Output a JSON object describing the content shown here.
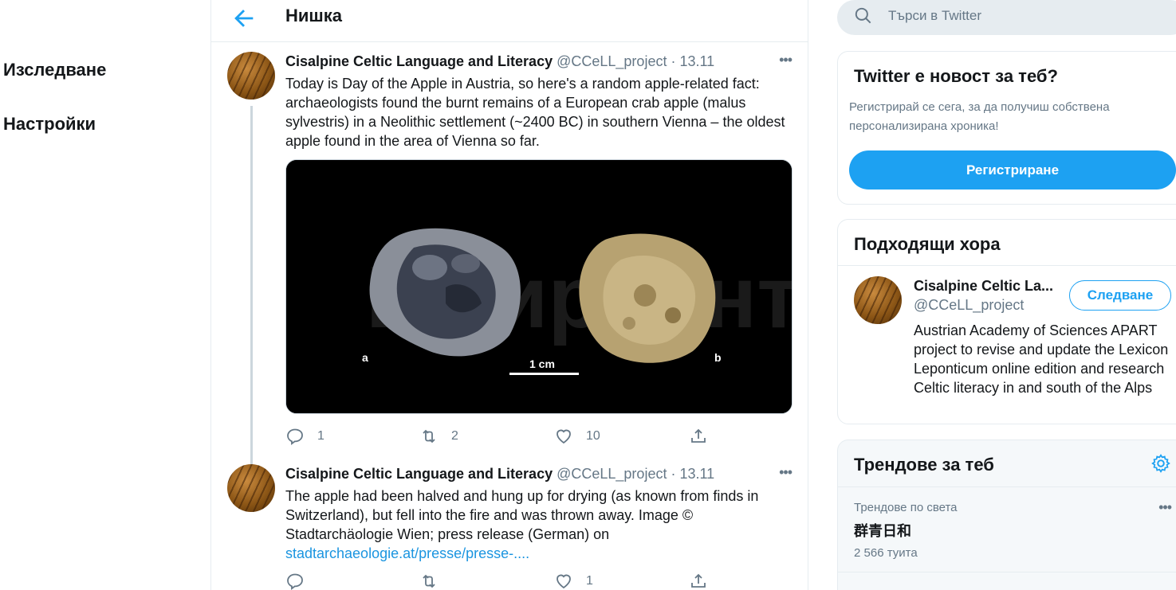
{
  "nav": {
    "items": [
      {
        "label": "Изследване"
      },
      {
        "label": "Настройки"
      }
    ]
  },
  "header": {
    "title": "Нишка"
  },
  "tweets": [
    {
      "name": "Cisalpine Celtic Language and Literacy",
      "handle": "@CCeLL_project",
      "date": "13.11",
      "text": "Today is Day of the Apple in Austria, so here's a random apple-related fact: archaeologists found the burnt remains of a European crab apple (malus sylvestris) in a Neolithic settlement (~2400 BC) in southern Vienna – the oldest apple found in the area of Vienna so far.",
      "image": {
        "label_a": "a",
        "label_b": "b",
        "scale": "1 cm"
      },
      "replies": "1",
      "retweets": "2",
      "likes": "10"
    },
    {
      "name": "Cisalpine Celtic Language and Literacy",
      "handle": "@CCeLL_project",
      "date": "13.11",
      "text": "The apple had been halved and hung up for drying (as known from finds in Switzerland), but fell into the fire and was thrown away. Image © Stadtarchäologie Wien; press release (German) on",
      "link": "stadtarchaeologie.at/presse/presse-....",
      "replies": "",
      "retweets": "",
      "likes": "1"
    }
  ],
  "search": {
    "placeholder": "Търси в Twitter"
  },
  "signup": {
    "title": "Twitter е новост за теб?",
    "subtitle": "Регистрирай се сега, за да получиш собствена персонализирана хроника!",
    "button": "Регистриране"
  },
  "who_to_follow": {
    "title": "Подходящи хора",
    "user": {
      "name": "Cisalpine Celtic La...",
      "handle": "@CCeLL_project",
      "bio": "Austrian Academy of Sciences APART project to revise and update the Lexicon Leponticum online edition and research Celtic literacy in and south of the Alps",
      "follow": "Следване"
    }
  },
  "trends": {
    "title": "Трендове за теб",
    "items": [
      {
        "context": "Трендове по света",
        "name": "群青日和",
        "count": "2 566 туита"
      }
    ]
  },
  "colors": {
    "accent": "#1da1f2",
    "secondary_text": "#657786",
    "border": "#e6ecf0"
  }
}
